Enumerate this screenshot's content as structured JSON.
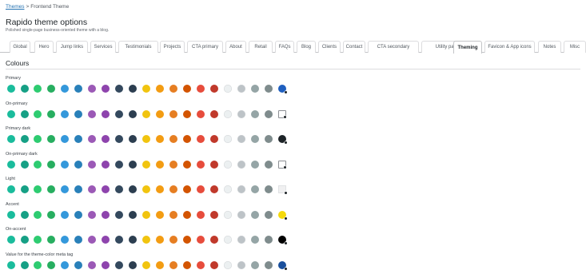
{
  "breadcrumb": {
    "link": "Themes",
    "sep": ">",
    "current": "Frontend Theme"
  },
  "header": {
    "title": "Rapido theme options",
    "description": "Polished single-page business-oriented theme with a blog."
  },
  "tabs": [
    {
      "label": "Global"
    },
    {
      "label": "Hero"
    },
    {
      "label": "Jump links"
    },
    {
      "label": "Services"
    },
    {
      "label": "Testimonials"
    },
    {
      "label": "Projects"
    },
    {
      "label": "CTA primary"
    },
    {
      "label": "About"
    },
    {
      "label": "Retail"
    },
    {
      "label": "FAQs"
    },
    {
      "label": "Blog"
    },
    {
      "label": "Clients"
    },
    {
      "label": "Contact"
    },
    {
      "label": "CTA secondary"
    },
    {
      "label": "Utility pages"
    },
    {
      "label": "Theming",
      "active": true
    },
    {
      "label": "Favicon & App icons"
    },
    {
      "label": "Notes"
    },
    {
      "label": "Misc"
    }
  ],
  "section": {
    "title": "Colours"
  },
  "palette": [
    "#1abc9c",
    "#16a085",
    "#2ecc71",
    "#27ae60",
    "#3498db",
    "#2980b9",
    "#9b59b6",
    "#8e44ad",
    "#34495e",
    "#2c3e50",
    "#f1c40f",
    "#f39c12",
    "#e67e22",
    "#d35400",
    "#e74c3c",
    "#c0392b",
    "#ecf0f1",
    "#bdc3c7",
    "#95a5a6",
    "#7f8c8d"
  ],
  "light_swatches": [
    16,
    17
  ],
  "color_rows": [
    {
      "label": "Primary",
      "selected_color": "#1f5fbf",
      "selected_shape": "circle"
    },
    {
      "label": "On-primary",
      "selected_color": "#ffffff",
      "selected_shape": "square-outline"
    },
    {
      "label": "Primary dark",
      "selected_color": "#1d2327",
      "selected_shape": "circle"
    },
    {
      "label": "On-primary dark",
      "selected_color": "#ffffff",
      "selected_shape": "square-outline"
    },
    {
      "label": "Light",
      "selected_color": "#f0f0f1",
      "selected_shape": "square"
    },
    {
      "label": "Accent",
      "selected_color": "#f5d90a",
      "selected_shape": "circle"
    },
    {
      "label": "On-accent",
      "selected_color": "#000000",
      "selected_shape": "circle"
    },
    {
      "label": "Value for the theme-color meta tag",
      "selected_color": "#1a4f9c",
      "selected_shape": "circle"
    }
  ]
}
